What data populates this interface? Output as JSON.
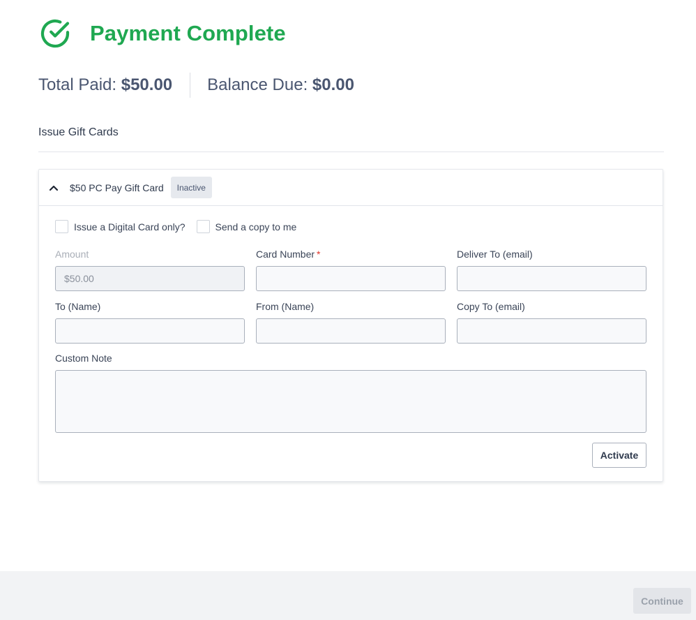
{
  "header": {
    "title": "Payment Complete",
    "icon": "check-circle-icon",
    "accent_color": "#1fa851"
  },
  "totals": {
    "paid_label": "Total Paid: ",
    "paid_value": "$50.00",
    "due_label": "Balance Due: ",
    "due_value": "$0.00"
  },
  "section": {
    "title": "Issue Gift Cards"
  },
  "gift_card": {
    "title": "$50 PC Pay Gift Card",
    "status": "Inactive",
    "collapse_icon": "chevron-up-icon",
    "digital_only_label": "Issue a Digital Card only?",
    "send_copy_label": "Send a copy to me",
    "amount": {
      "label": "Amount",
      "value": "$50.00"
    },
    "card_number": {
      "label": "Card Number",
      "required_mark": "*",
      "value": ""
    },
    "deliver_to": {
      "label": "Deliver To (email)",
      "value": ""
    },
    "to_name": {
      "label": "To (Name)",
      "value": ""
    },
    "from_name": {
      "label": "From (Name)",
      "value": ""
    },
    "copy_to": {
      "label": "Copy To (email)",
      "value": ""
    },
    "custom_note": {
      "label": "Custom Note",
      "value": ""
    },
    "activate_label": "Activate"
  },
  "footer": {
    "continue_label": "Continue"
  }
}
